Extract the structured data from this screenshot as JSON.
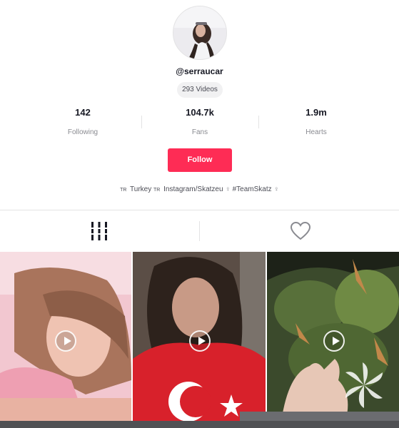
{
  "profile": {
    "username": "@serraucar",
    "videos_count": "293 Videos",
    "stats": [
      {
        "value": "142",
        "label": "Following"
      },
      {
        "value": "104.7k",
        "label": "Fans"
      },
      {
        "value": "1.9m",
        "label": "Hearts"
      }
    ],
    "follow_label": "Follow",
    "bio": {
      "flag1": "TR",
      "text1": "Turkey",
      "flag2": "TR",
      "text2": "Instagram/Skatzeu",
      "emoji1": "♀",
      "text3": "#TeamSkatz",
      "emoji2": "♀"
    }
  },
  "tabs": [
    {
      "icon": "video-grid-icon",
      "active": true
    },
    {
      "icon": "heart-icon",
      "active": false
    }
  ],
  "videos": [
    {
      "icon": "play-icon"
    },
    {
      "icon": "play-icon"
    },
    {
      "icon": "play-icon"
    }
  ],
  "colors": {
    "accent": "#fe2c55",
    "text_primary": "#161823",
    "text_secondary": "#8a8b91",
    "divider": "#e3e3e4"
  }
}
